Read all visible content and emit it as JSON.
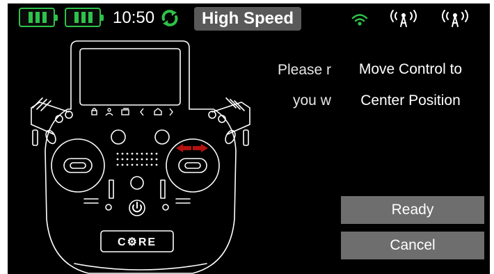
{
  "status_bar": {
    "time": "10:50",
    "mode": "High Speed",
    "icons": [
      "battery-icon",
      "battery-icon",
      "sync-icon",
      "wifi-icon",
      "antenna-icon",
      "antenna-icon"
    ],
    "colors": {
      "battery": "#2ec24a",
      "sync": "#2ec24a",
      "wifi": "#2ec24a"
    }
  },
  "transmitter": {
    "logo": "C⚙RE"
  },
  "background_message": {
    "line1": "Please r",
    "line2": "you w"
  },
  "dialog": {
    "line1": "Move Control to",
    "line2": "Center Position",
    "ready_label": "Ready",
    "cancel_label": "Cancel"
  }
}
